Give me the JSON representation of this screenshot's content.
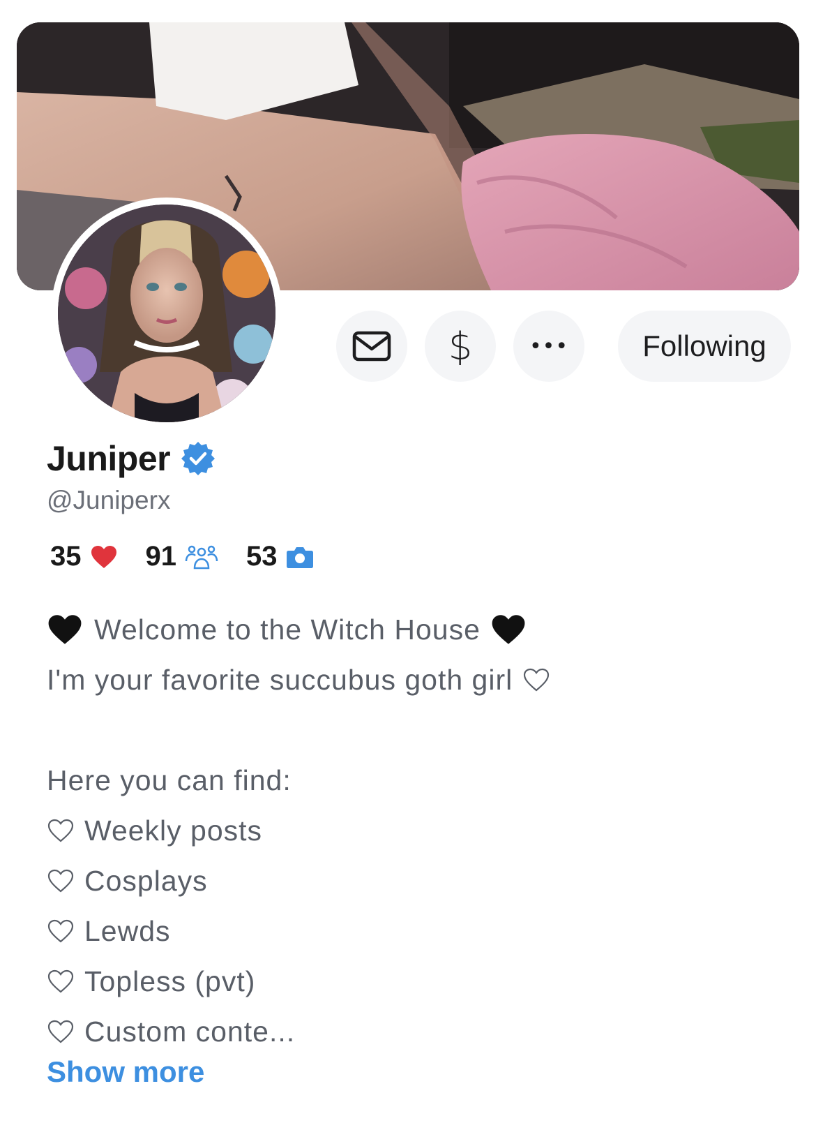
{
  "profile": {
    "name": "Juniper",
    "handle": "@Juniperx",
    "verified": true
  },
  "actions": {
    "message_icon": "envelope-icon",
    "tip_symbol": "$",
    "more_symbol": "•••",
    "follow_label": "Following"
  },
  "stats": {
    "likes": "35",
    "likes_icon": "heart-icon",
    "subscribers": "91",
    "subscribers_icon": "people-icon",
    "photos": "53",
    "photos_icon": "camera-icon"
  },
  "bio": {
    "line1": "Welcome to the Witch House",
    "line2": "I'm your favorite succubus goth girl",
    "line3": "Here you can find:",
    "items": [
      "Weekly posts",
      "Cosplays",
      "Lewds",
      "Topless (pvt)",
      "Custom conte..."
    ]
  },
  "show_more_label": "Show more",
  "colors": {
    "accent": "#3d8fe0",
    "heart": "#e0343c",
    "button_bg": "#f4f5f7",
    "text_secondary": "#595e67"
  }
}
